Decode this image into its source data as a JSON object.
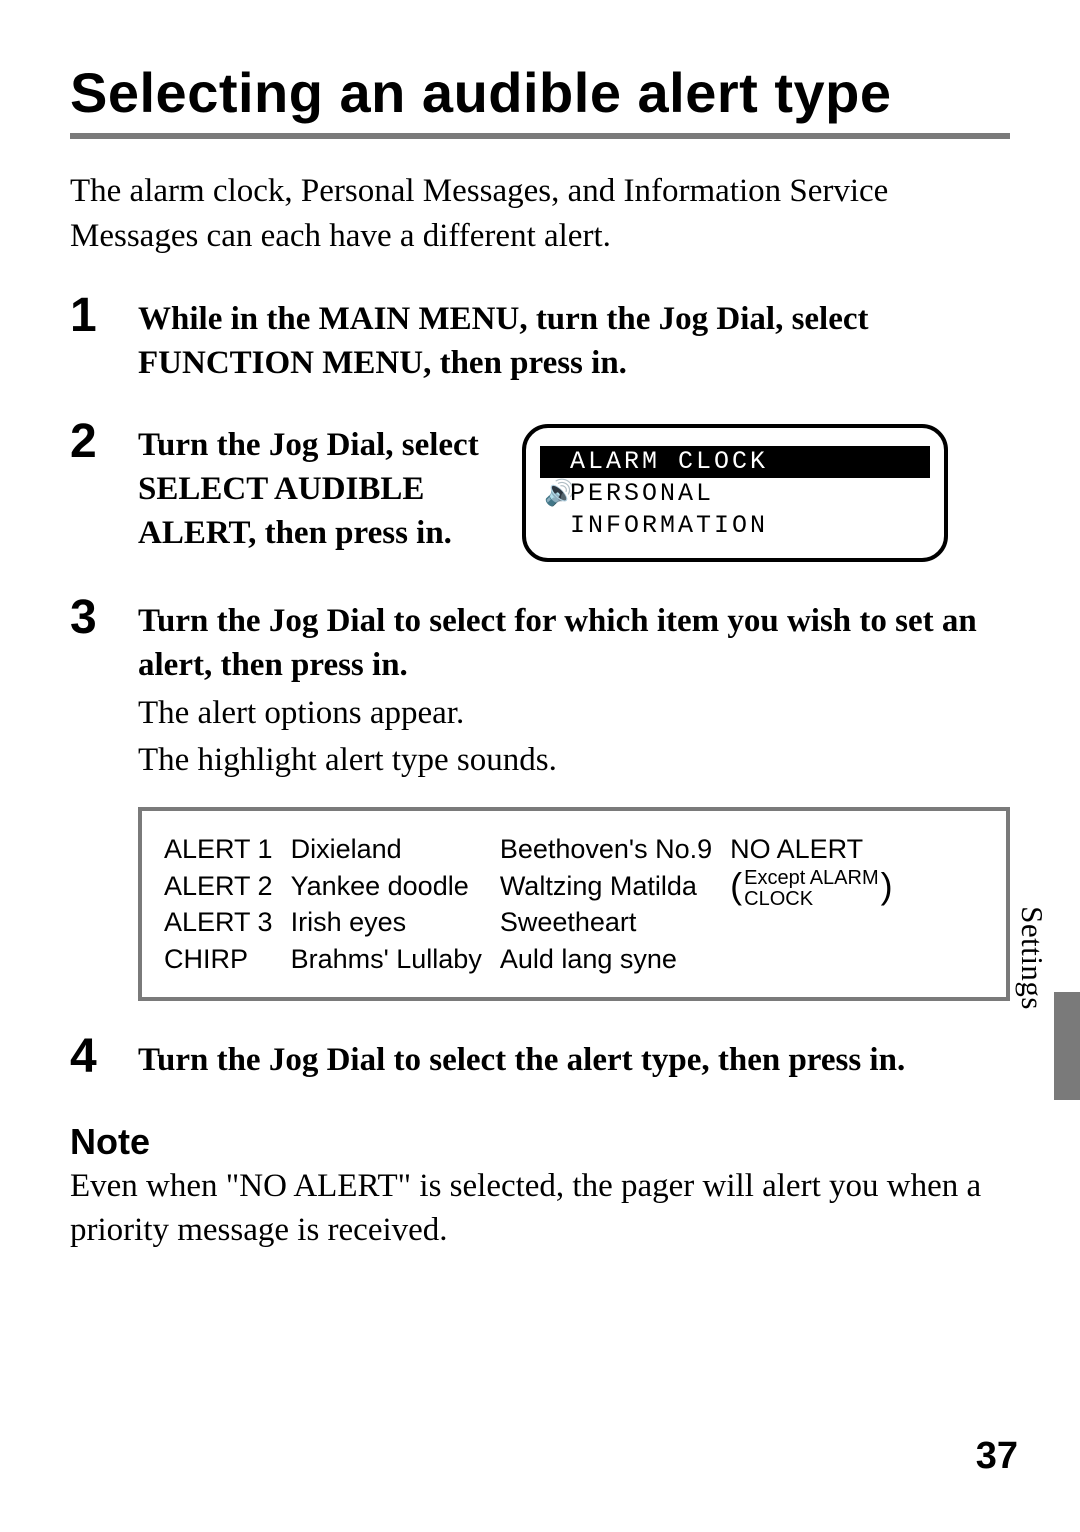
{
  "title": "Selecting an audible alert type",
  "intro": "The alarm clock, Personal Messages, and Information Service Messages can each have a different alert.",
  "steps": {
    "s1": {
      "head": "While in the MAIN MENU, turn the Jog Dial, select FUNCTION MENU, then press in."
    },
    "s2": {
      "head": "Turn the Jog Dial, select SELECT AUDIBLE ALERT, then press in."
    },
    "s3": {
      "head": "Turn the Jog Dial to select for which item you wish to set an alert, then press in.",
      "body1": "The alert options appear.",
      "body2": "The highlight alert type sounds."
    },
    "s4": {
      "head": "Turn the Jog Dial to select the alert type, then press in."
    }
  },
  "lcd": {
    "row1": "ALARM CLOCK",
    "row2_icon": "🔊",
    "row2": "PERSONAL",
    "row3": "INFORMATION"
  },
  "alerts": {
    "col1": {
      "r1": "ALERT 1",
      "r2": "ALERT 2",
      "r3": "ALERT 3",
      "r4": "CHIRP"
    },
    "col2": {
      "r1": "Dixieland",
      "r2": "Yankee doodle",
      "r3": "Irish eyes",
      "r4": "Brahms' Lullaby"
    },
    "col3": {
      "r1": "Beethoven's No.9",
      "r2": "Waltzing Matilda",
      "r3": "Sweetheart",
      "r4": "Auld lang syne"
    },
    "col4": {
      "r1": "NO ALERT",
      "paren_l": "(",
      "paren_line1": "Except ALARM",
      "paren_line2": "CLOCK",
      "paren_r": ")"
    }
  },
  "note": {
    "heading": "Note",
    "body": "Even when \"NO ALERT\" is selected, the pager will alert you when a priority message is received."
  },
  "side_tab": "Settings",
  "page_number": "37"
}
